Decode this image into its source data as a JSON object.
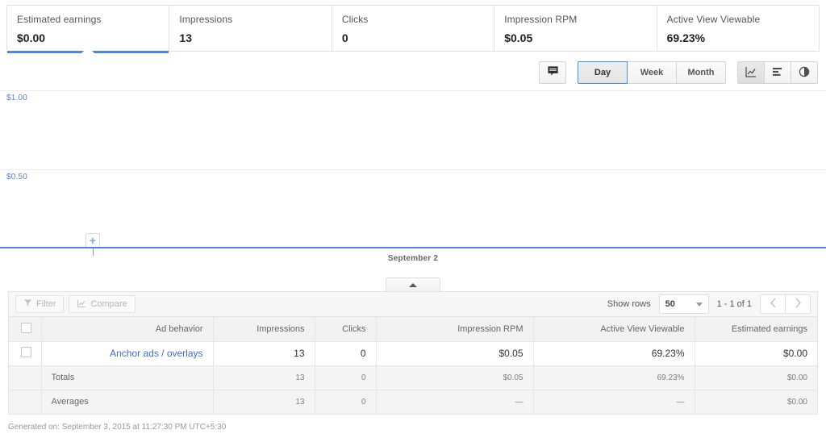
{
  "cards": [
    {
      "label": "Estimated earnings",
      "value": "$0.00",
      "selected": true
    },
    {
      "label": "Impressions",
      "value": "13",
      "selected": false
    },
    {
      "label": "Clicks",
      "value": "0",
      "selected": false
    },
    {
      "label": "Impression RPM",
      "value": "$0.05",
      "selected": false
    },
    {
      "label": "Active View Viewable",
      "value": "69.23%",
      "selected": false
    }
  ],
  "chart_toolbar": {
    "annotation_icon": "speech-bubble-icon",
    "granularity": [
      {
        "label": "Day",
        "active": true
      },
      {
        "label": "Week",
        "active": false
      },
      {
        "label": "Month",
        "active": false
      }
    ],
    "chart_types": [
      {
        "icon": "line-chart-icon",
        "active": true
      },
      {
        "icon": "bar-chart-icon",
        "active": false
      },
      {
        "icon": "pie-chart-icon",
        "active": false
      }
    ]
  },
  "chart_data": {
    "type": "line",
    "title": "",
    "xlabel": "",
    "ylabel": "",
    "categories": [
      "September 2"
    ],
    "x_tick_labels": [
      "September 2"
    ],
    "y_tick_labels": [
      "$1.00",
      "$0.50",
      ""
    ],
    "ylim": [
      0,
      1.25
    ],
    "yticks": [
      1.0,
      0.5,
      0.0
    ],
    "grid": true,
    "legend": false,
    "series": [
      {
        "name": "Estimated earnings",
        "values": [
          0.0
        ],
        "color": "#4a86e8"
      }
    ],
    "annotations": [
      {
        "label": "+",
        "x": "September 2",
        "y": 0.0,
        "name": "add-annotation-marker"
      }
    ],
    "axis_label_color": "#5b7de0",
    "line_color": "#4a86e8"
  },
  "collapse_tab": {
    "icon": "caret-up-icon"
  },
  "table_toolbar": {
    "filter_label": "Filter",
    "filter_icon": "funnel-icon",
    "compare_label": "Compare",
    "compare_icon": "line-chart-icon",
    "show_rows_label": "Show rows",
    "rows_value": "50",
    "range_label": "1 - 1 of 1",
    "prev_icon": "chevron-left-icon",
    "next_icon": "chevron-right-icon"
  },
  "table": {
    "columns": [
      "Ad behavior",
      "Impressions",
      "Clicks",
      "Impression RPM",
      "Active View Viewable",
      "Estimated earnings"
    ],
    "rows": [
      {
        "name": "Anchor ads / overlays",
        "impressions": "13",
        "clicks": "0",
        "rpm": "$0.05",
        "viewable": "69.23%",
        "earnings": "$0.00"
      }
    ],
    "totals": {
      "name": "Totals",
      "impressions": "13",
      "clicks": "0",
      "rpm": "$0.05",
      "viewable": "69.23%",
      "earnings": "$0.00"
    },
    "averages": {
      "name": "Averages",
      "impressions": "13",
      "clicks": "0",
      "rpm": "—",
      "viewable": "—",
      "earnings": "$0.00"
    }
  },
  "footer": {
    "text": "Generated on: September 3, 2015 at 11:27:30 PM UTC+5:30"
  }
}
